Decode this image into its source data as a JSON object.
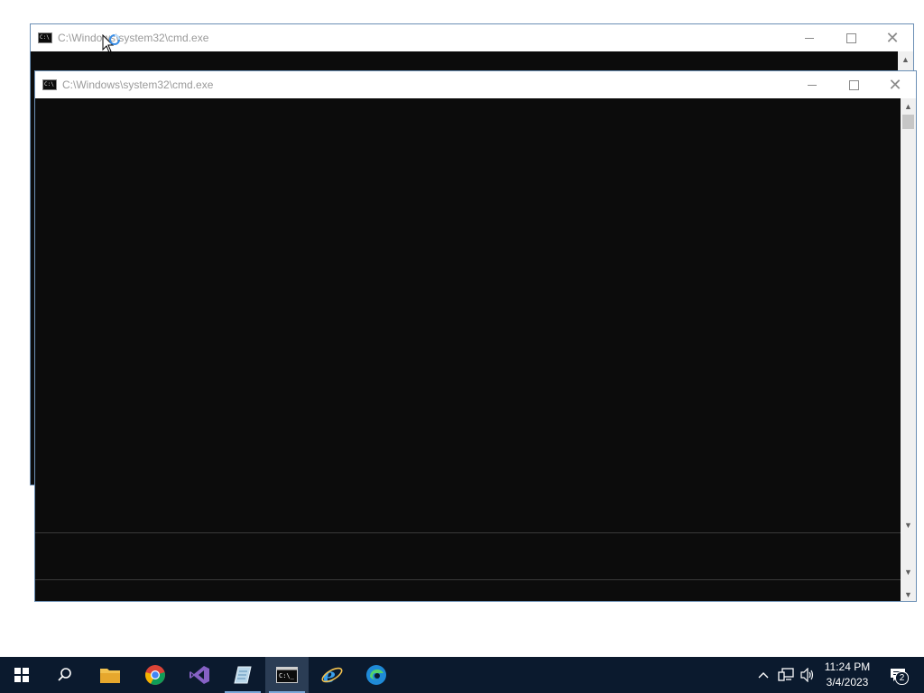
{
  "back_window": {
    "title": "C:\\Windows\\system32\\cmd.exe",
    "icon": "cmd-icon"
  },
  "front_window": {
    "title": "C:\\Windows\\system32\\cmd.exe",
    "icon": "cmd-icon"
  },
  "caption_buttons": {
    "minimize": "minimize",
    "maximize": "maximize",
    "close": "✕"
  },
  "taskbar": {
    "items": [
      {
        "name": "start",
        "icon": "windows-logo-icon"
      },
      {
        "name": "search",
        "icon": "search-icon"
      },
      {
        "name": "file-explorer",
        "icon": "folder-icon"
      },
      {
        "name": "chrome",
        "icon": "chrome-icon"
      },
      {
        "name": "visual-studio",
        "icon": "visual-studio-icon"
      },
      {
        "name": "notepad",
        "icon": "notepad-icon"
      },
      {
        "name": "cmd",
        "icon": "cmd-icon",
        "active": true
      },
      {
        "name": "internet-explorer",
        "icon": "ie-icon"
      },
      {
        "name": "edge",
        "icon": "edge-icon"
      }
    ],
    "tray": {
      "chevron": "^",
      "time": "11:24 PM",
      "date": "3/4/2023",
      "notification_count": "2"
    }
  },
  "colors": {
    "terminal_bg": "#0c0c0c",
    "taskbar_bg": "#0b1a2e",
    "accent": "#7aa7d8"
  }
}
